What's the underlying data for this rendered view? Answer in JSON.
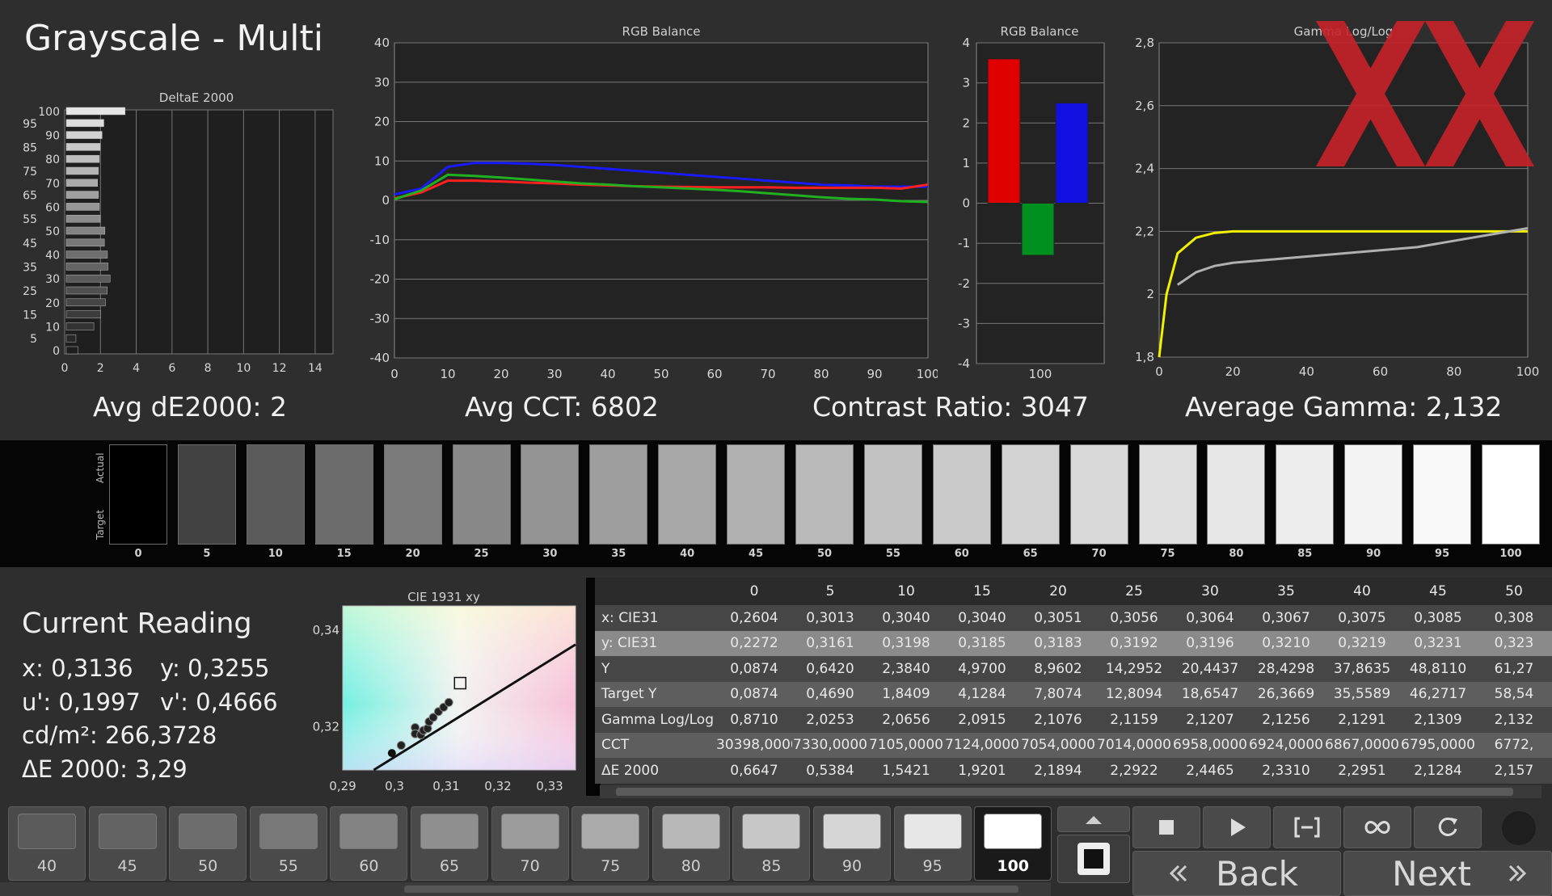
{
  "title": "Grayscale - Multi",
  "stats": {
    "avg_de": "Avg dE2000: 2",
    "avg_cct": "Avg CCT: 6802",
    "contrast": "Contrast Ratio: 3047",
    "avg_gamma": "Average Gamma: 2,132"
  },
  "chart_data": [
    {
      "type": "bar",
      "title": "DeltaE 2000",
      "orientation": "horizontal",
      "categories": [
        "0",
        "5",
        "10",
        "15",
        "20",
        "25",
        "30",
        "35",
        "40",
        "45",
        "50",
        "55",
        "60",
        "65",
        "70",
        "75",
        "80",
        "85",
        "90",
        "95",
        "100"
      ],
      "values": [
        0.66,
        0.54,
        1.54,
        1.92,
        2.19,
        2.29,
        2.45,
        2.33,
        2.3,
        2.13,
        2.16,
        1.9,
        1.85,
        1.8,
        1.75,
        1.8,
        1.85,
        1.9,
        2.0,
        2.1,
        3.29
      ],
      "xlim": [
        0,
        15
      ],
      "xticks": [
        "0",
        "2",
        "4",
        "6",
        "8",
        "10",
        "12",
        "14"
      ],
      "yticks": [
        "0",
        "5",
        "10",
        "15",
        "20",
        "25",
        "30",
        "35",
        "40",
        "45",
        "50",
        "55",
        "60",
        "65",
        "70",
        "75",
        "80",
        "85",
        "90",
        "95",
        "100"
      ]
    },
    {
      "type": "line",
      "title": "RGB Balance",
      "x": [
        0,
        5,
        10,
        15,
        20,
        25,
        30,
        35,
        40,
        45,
        50,
        55,
        60,
        65,
        70,
        75,
        80,
        85,
        90,
        95,
        100
      ],
      "series": [
        {
          "color": "#1a1aff",
          "values": [
            1.5,
            3,
            8.5,
            9.5,
            9.5,
            9.3,
            9,
            8.5,
            8,
            7.5,
            7,
            6.5,
            6,
            5.5,
            5,
            4.5,
            4,
            3.8,
            3.5,
            3.5,
            3.5
          ]
        },
        {
          "color": "#ff2020",
          "values": [
            0.5,
            2,
            5,
            5,
            4.8,
            4.5,
            4.3,
            4,
            3.8,
            3.6,
            3.5,
            3.4,
            3.3,
            3.3,
            3.3,
            3.2,
            3.2,
            3.2,
            3.2,
            3,
            4
          ]
        },
        {
          "color": "#20b020",
          "values": [
            0.3,
            2.5,
            6.5,
            6.2,
            5.8,
            5.3,
            4.8,
            4.3,
            4,
            3.6,
            3.3,
            3,
            2.7,
            2.3,
            1.8,
            1.3,
            0.8,
            0.4,
            0.2,
            -0.2,
            -0.4
          ]
        }
      ],
      "xlim": [
        0,
        100
      ],
      "ylim": [
        -40,
        40
      ],
      "xticks": [
        "0",
        "10",
        "20",
        "30",
        "40",
        "50",
        "60",
        "70",
        "80",
        "90",
        "100"
      ],
      "yticks": [
        "40",
        "30",
        "20",
        "10",
        "0",
        "-10",
        "-20",
        "-30",
        "-40"
      ]
    },
    {
      "type": "bar",
      "title": "RGB Balance",
      "categories": [
        "R",
        "G",
        "B"
      ],
      "x_label": "100",
      "values": [
        3.6,
        -1.3,
        2.5
      ],
      "colors": [
        "#e00000",
        "#009020",
        "#1010e0"
      ],
      "ylim": [
        -4,
        4
      ],
      "yticks": [
        "4",
        "3",
        "2",
        "1",
        "0",
        "-1",
        "-2",
        "-3",
        "-4"
      ]
    },
    {
      "type": "line",
      "title": "Gamma Log/Log",
      "x": [
        0,
        2,
        5,
        10,
        15,
        20,
        30,
        40,
        50,
        60,
        70,
        80,
        90,
        100
      ],
      "series": [
        {
          "color": "#f0f000",
          "values": [
            1.8,
            2.0,
            2.13,
            2.18,
            2.195,
            2.2,
            2.2,
            2.2,
            2.2,
            2.2,
            2.2,
            2.2,
            2.2,
            2.2
          ]
        },
        {
          "color": "#b0b0b0",
          "values": [
            null,
            null,
            2.03,
            2.07,
            2.09,
            2.1,
            2.11,
            2.12,
            2.13,
            2.14,
            2.15,
            2.17,
            2.19,
            2.21
          ]
        }
      ],
      "xlim": [
        0,
        100
      ],
      "ylim": [
        1.8,
        2.8
      ],
      "xticks": [
        "0",
        "20",
        "40",
        "60",
        "80",
        "100"
      ],
      "yticks": [
        "2,8",
        "2,6",
        "2,4",
        "2,2",
        "2",
        "1,8"
      ]
    },
    {
      "type": "scatter",
      "title": "CIE 1931 xy",
      "points": [
        [
          0.3013,
          0.3161
        ],
        [
          0.304,
          0.3198
        ],
        [
          0.304,
          0.3185
        ],
        [
          0.3051,
          0.3183
        ],
        [
          0.3056,
          0.3192
        ],
        [
          0.3064,
          0.3196
        ],
        [
          0.3067,
          0.321
        ],
        [
          0.3075,
          0.3219
        ],
        [
          0.3085,
          0.3231
        ],
        [
          0.3095,
          0.324
        ],
        [
          0.3105,
          0.325
        ],
        [
          0.2604,
          0.2272
        ]
      ],
      "target": [
        0.3127,
        0.329
      ],
      "xlim": [
        0.29,
        0.335
      ],
      "ylim": [
        0.311,
        0.345
      ],
      "xticks": [
        "0,29",
        "0,3",
        "0,31",
        "0,32",
        "0,33"
      ],
      "yticks": [
        "0,34",
        "0,32"
      ]
    }
  ],
  "swatches": {
    "actual_label": "Actual",
    "target_label": "Target",
    "labels": [
      "0",
      "5",
      "10",
      "15",
      "20",
      "25",
      "30",
      "35",
      "40",
      "45",
      "50",
      "55",
      "60",
      "65",
      "70",
      "75",
      "80",
      "85",
      "90",
      "95",
      "100"
    ]
  },
  "reading": {
    "title": "Current Reading",
    "x": "x: 0,3136",
    "y": "y: 0,3255",
    "u": "u': 0,1997",
    "v": "v': 0,4666",
    "cd": "cd/m²: 266,3728",
    "de": "ΔE 2000: 3,29"
  },
  "table": {
    "columns": [
      "0",
      "5",
      "10",
      "15",
      "20",
      "25",
      "30",
      "35",
      "40",
      "45",
      "50"
    ],
    "rows": [
      {
        "label": "x: CIE31",
        "values": [
          "0,2604",
          "0,3013",
          "0,3040",
          "0,3040",
          "0,3051",
          "0,3056",
          "0,3064",
          "0,3067",
          "0,3075",
          "0,3085",
          "0,308"
        ]
      },
      {
        "label": "y: CIE31",
        "values": [
          "0,2272",
          "0,3161",
          "0,3198",
          "0,3185",
          "0,3183",
          "0,3192",
          "0,3196",
          "0,3210",
          "0,3219",
          "0,3231",
          "0,323"
        ]
      },
      {
        "label": "Y",
        "values": [
          "0,0874",
          "0,6420",
          "2,3840",
          "4,9700",
          "8,9602",
          "14,2952",
          "20,4437",
          "28,4298",
          "37,8635",
          "48,8110",
          "61,27"
        ]
      },
      {
        "label": "Target Y",
        "values": [
          "0,0874",
          "0,4690",
          "1,8409",
          "4,1284",
          "7,8074",
          "12,8094",
          "18,6547",
          "26,3669",
          "35,5589",
          "46,2717",
          "58,54"
        ]
      },
      {
        "label": "Gamma Log/Log",
        "values": [
          "0,8710",
          "2,0253",
          "2,0656",
          "2,0915",
          "2,1076",
          "2,1159",
          "2,1207",
          "2,1256",
          "2,1291",
          "2,1309",
          "2,132"
        ]
      },
      {
        "label": "CCT",
        "values": [
          "30398,0000",
          "7330,0000",
          "7105,0000",
          "7124,0000",
          "7054,0000",
          "7014,0000",
          "6958,0000",
          "6924,0000",
          "6867,0000",
          "6795,0000",
          "6772,"
        ]
      },
      {
        "label": "ΔE 2000",
        "values": [
          "0,6647",
          "0,5384",
          "1,5421",
          "1,9201",
          "2,1894",
          "2,2922",
          "2,4465",
          "2,3310",
          "2,2951",
          "2,1284",
          "2,157"
        ]
      }
    ]
  },
  "patch_buttons": [
    {
      "label": "40",
      "shade": "#5a5a5a"
    },
    {
      "label": "45",
      "shade": "#636363"
    },
    {
      "label": "50",
      "shade": "#6d6d6d"
    },
    {
      "label": "55",
      "shade": "#787878"
    },
    {
      "label": "60",
      "shade": "#838383"
    },
    {
      "label": "65",
      "shade": "#8f8f8f"
    },
    {
      "label": "70",
      "shade": "#9c9c9c"
    },
    {
      "label": "75",
      "shade": "#aaaaaa"
    },
    {
      "label": "80",
      "shade": "#b8b8b8"
    },
    {
      "label": "85",
      "shade": "#c7c7c7"
    },
    {
      "label": "90",
      "shade": "#d6d6d6"
    },
    {
      "label": "95",
      "shade": "#e6e6e6"
    },
    {
      "label": "100",
      "shade": "#ffffff"
    }
  ],
  "nav": {
    "back": "Back",
    "next": "Next"
  },
  "icons": [
    "stop-icon",
    "play-icon",
    "fit-range-icon",
    "loop-icon",
    "refresh-icon",
    "up-arrow-icon",
    "stop-square-icon",
    "double-left-chevron-icon",
    "double-right-chevron-icon"
  ]
}
